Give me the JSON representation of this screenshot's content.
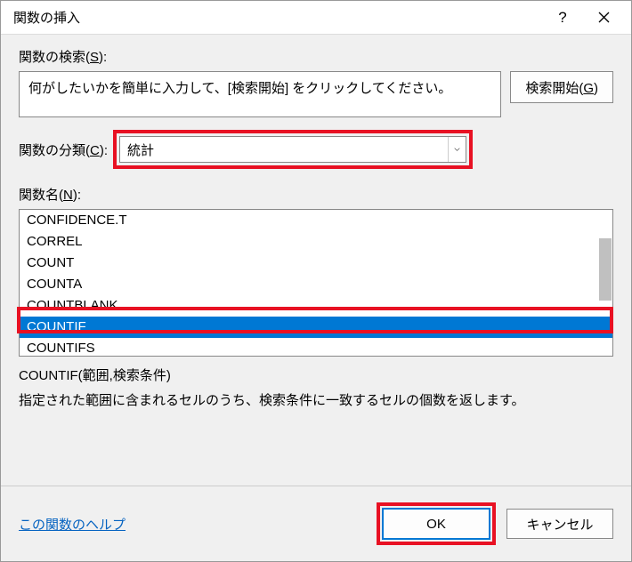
{
  "titlebar": {
    "title": "関数の挿入",
    "help": "?",
    "close": "×"
  },
  "search": {
    "label_pre": "関数の検索(",
    "label_key": "S",
    "label_post": "):",
    "text": "何がしたいかを簡単に入力して、[検索開始] をクリックしてください。",
    "button_pre": "検索開始(",
    "button_key": "G",
    "button_post": ")"
  },
  "category": {
    "label_pre": "関数の分類(",
    "label_key": "C",
    "label_post": "):",
    "selected": "統計"
  },
  "funclist": {
    "label_pre": "関数名(",
    "label_key": "N",
    "label_post": "):",
    "items": [
      "CONFIDENCE.T",
      "CORREL",
      "COUNT",
      "COUNTA",
      "COUNTBLANK",
      "COUNTIF",
      "COUNTIFS"
    ],
    "selected_index": 5
  },
  "detail": {
    "syntax": "COUNTIF(範囲,検索条件)",
    "description": "指定された範囲に含まれるセルのうち、検索条件に一致するセルの個数を返します。"
  },
  "footer": {
    "help_link": "この関数のヘルプ",
    "ok": "OK",
    "cancel": "キャンセル"
  }
}
